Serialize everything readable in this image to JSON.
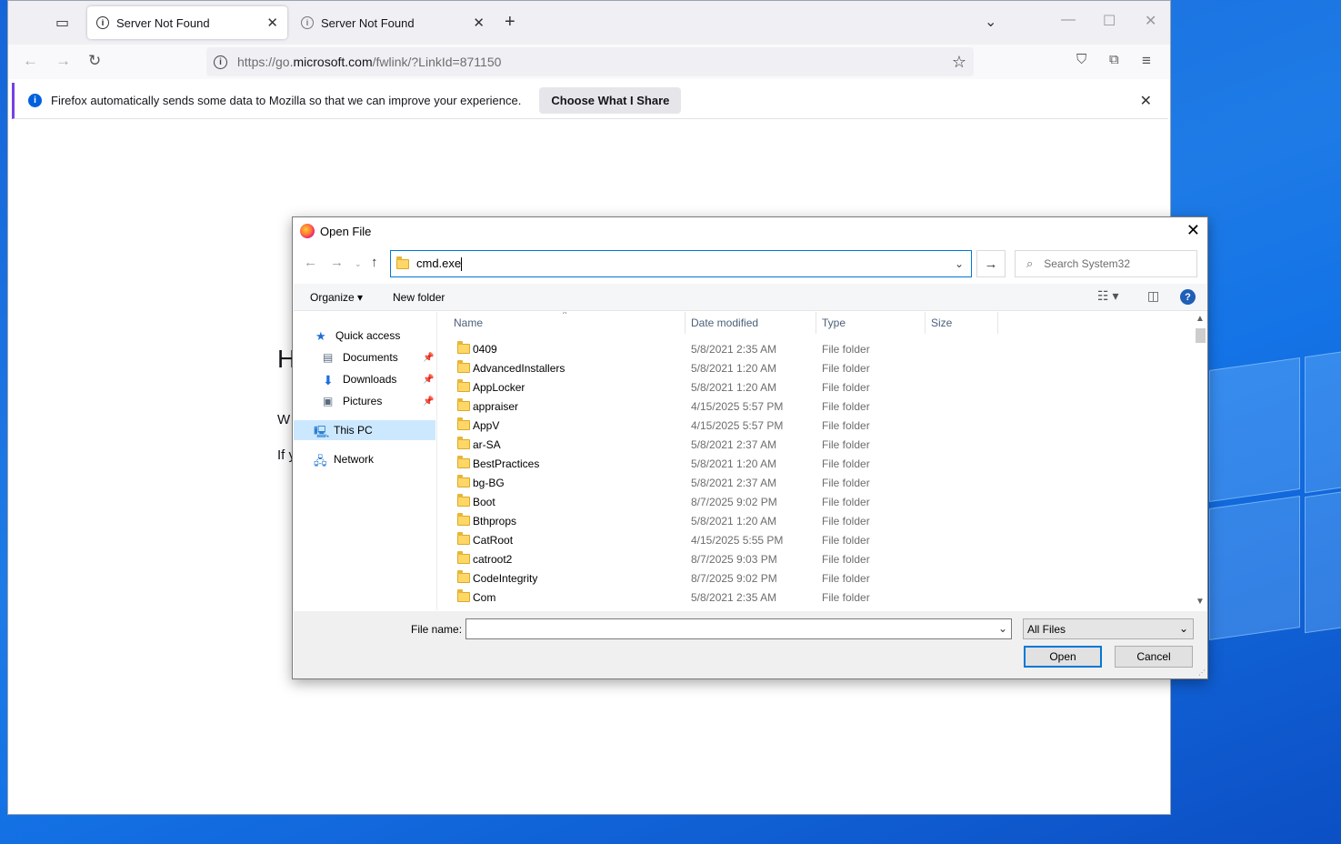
{
  "browser": {
    "tabs": [
      {
        "title": "Server Not Found",
        "active": true
      },
      {
        "title": "Server Not Found",
        "active": false
      }
    ],
    "url_prefix": "https://go.",
    "url_domain": "microsoft.com",
    "url_path": "/fwlink/?LinkId=871150",
    "notification": {
      "text": "Firefox automatically sends some data to Mozilla so that we can improve your experience.",
      "button": "Choose What I Share"
    },
    "page_fragments": [
      "H",
      "W",
      "If y"
    ]
  },
  "dialog": {
    "title": "Open File",
    "address_value": "cmd.exe",
    "search_placeholder": "Search System32",
    "organize_label": "Organize ▾",
    "new_folder_label": "New folder",
    "nav": {
      "quick_access": "Quick access",
      "documents": "Documents",
      "downloads": "Downloads",
      "pictures": "Pictures",
      "this_pc": "This PC",
      "network": "Network"
    },
    "columns": {
      "name": "Name",
      "date": "Date modified",
      "type": "Type",
      "size": "Size"
    },
    "files": [
      {
        "name": "0409",
        "date": "5/8/2021 2:35 AM",
        "type": "File folder"
      },
      {
        "name": "AdvancedInstallers",
        "date": "5/8/2021 1:20 AM",
        "type": "File folder"
      },
      {
        "name": "AppLocker",
        "date": "5/8/2021 1:20 AM",
        "type": "File folder"
      },
      {
        "name": "appraiser",
        "date": "4/15/2025 5:57 PM",
        "type": "File folder"
      },
      {
        "name": "AppV",
        "date": "4/15/2025 5:57 PM",
        "type": "File folder"
      },
      {
        "name": "ar-SA",
        "date": "5/8/2021 2:37 AM",
        "type": "File folder"
      },
      {
        "name": "BestPractices",
        "date": "5/8/2021 1:20 AM",
        "type": "File folder"
      },
      {
        "name": "bg-BG",
        "date": "5/8/2021 2:37 AM",
        "type": "File folder"
      },
      {
        "name": "Boot",
        "date": "8/7/2025 9:02 PM",
        "type": "File folder"
      },
      {
        "name": "Bthprops",
        "date": "5/8/2021 1:20 AM",
        "type": "File folder"
      },
      {
        "name": "CatRoot",
        "date": "4/15/2025 5:55 PM",
        "type": "File folder"
      },
      {
        "name": "catroot2",
        "date": "8/7/2025 9:03 PM",
        "type": "File folder"
      },
      {
        "name": "CodeIntegrity",
        "date": "8/7/2025 9:02 PM",
        "type": "File folder"
      },
      {
        "name": "Com",
        "date": "5/8/2021 2:35 AM",
        "type": "File folder"
      }
    ],
    "file_name_label": "File name:",
    "file_name_value": "",
    "filter_value": "All Files",
    "open_label": "Open",
    "cancel_label": "Cancel"
  }
}
